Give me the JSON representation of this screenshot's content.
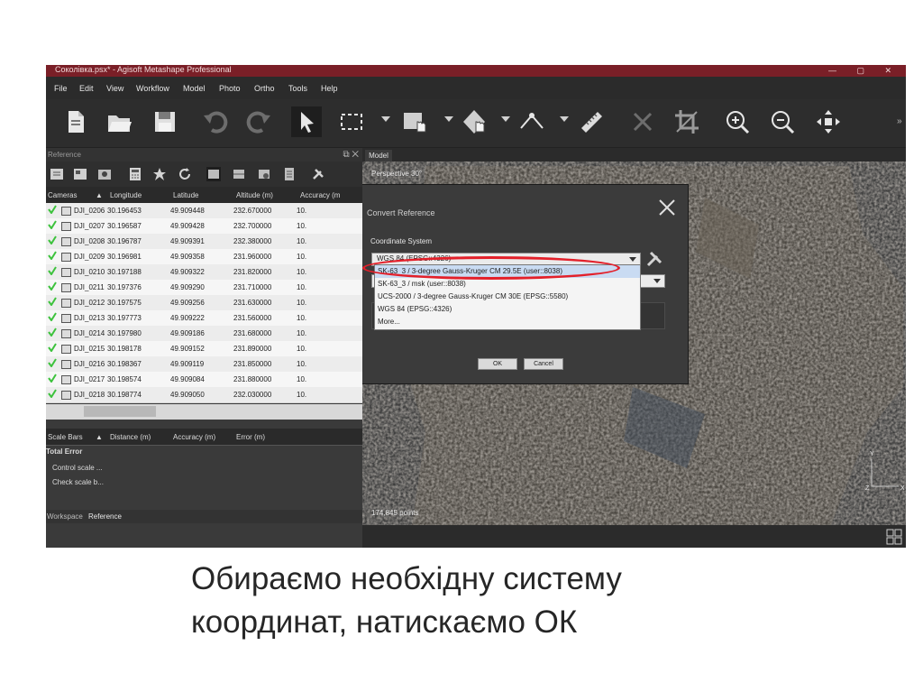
{
  "window": {
    "title": "Соколівка.psx* - Agisoft Metashape Professional",
    "controls": "— ▢ ✕"
  },
  "menu": [
    "File",
    "Edit",
    "View",
    "Workflow",
    "Model",
    "Photo",
    "Ortho",
    "Tools",
    "Help"
  ],
  "toolbar": {
    "icons": [
      "new-document-icon",
      "open-folder-icon",
      "save-icon",
      "undo-icon",
      "redo-icon",
      "pointer-icon",
      "rectangle-selection-icon",
      "move-object-icon",
      "navigate-region-icon",
      "ruler-line-icon",
      "ruler-icon",
      "delete-icon",
      "crop-icon",
      "zoom-in-icon",
      "zoom-out-icon",
      "reset-view-icon"
    ],
    "overflow": "»"
  },
  "reference_panel": {
    "title": "Reference",
    "columns": [
      "Cameras",
      "Longitude",
      "Latitude",
      "Altitude (m)",
      "Accuracy (m"
    ],
    "rows": [
      {
        "label": "DJI_0206",
        "longitude": "30.196453",
        "latitude": "49.909448",
        "altitude": "232.670000",
        "accuracy": "10."
      },
      {
        "label": "DJI_0207",
        "longitude": "30.196587",
        "latitude": "49.909428",
        "altitude": "232.700000",
        "accuracy": "10."
      },
      {
        "label": "DJI_0208",
        "longitude": "30.196787",
        "latitude": "49.909391",
        "altitude": "232.380000",
        "accuracy": "10."
      },
      {
        "label": "DJI_0209",
        "longitude": "30.196981",
        "latitude": "49.909358",
        "altitude": "231.960000",
        "accuracy": "10."
      },
      {
        "label": "DJI_0210",
        "longitude": "30.197188",
        "latitude": "49.909322",
        "altitude": "231.820000",
        "accuracy": "10."
      },
      {
        "label": "DJI_0211",
        "longitude": "30.197376",
        "latitude": "49.909290",
        "altitude": "231.710000",
        "accuracy": "10."
      },
      {
        "label": "DJI_0212",
        "longitude": "30.197575",
        "latitude": "49.909256",
        "altitude": "231.630000",
        "accuracy": "10."
      },
      {
        "label": "DJI_0213",
        "longitude": "30.197773",
        "latitude": "49.909222",
        "altitude": "231.560000",
        "accuracy": "10."
      },
      {
        "label": "DJI_0214",
        "longitude": "30.197980",
        "latitude": "49.909186",
        "altitude": "231.680000",
        "accuracy": "10."
      },
      {
        "label": "DJI_0215",
        "longitude": "30.198178",
        "latitude": "49.909152",
        "altitude": "231.890000",
        "accuracy": "10."
      },
      {
        "label": "DJI_0216",
        "longitude": "30.198367",
        "latitude": "49.909119",
        "altitude": "231.850000",
        "accuracy": "10."
      },
      {
        "label": "DJI_0217",
        "longitude": "30.198574",
        "latitude": "49.909084",
        "altitude": "231.880000",
        "accuracy": "10."
      },
      {
        "label": "DJI_0218",
        "longitude": "30.198774",
        "latitude": "49.909050",
        "altitude": "232.030000",
        "accuracy": "10."
      }
    ],
    "scale_bars_columns": [
      "Scale Bars",
      "Distance (m)",
      "Accuracy (m)",
      "Error (m)"
    ],
    "total_error": "Total Error",
    "control_scale": "Control scale ...",
    "check_scale": "Check scale b...",
    "tabs": [
      "Workspace",
      "Reference"
    ]
  },
  "view": {
    "tab": "Model",
    "perspective": "Perspective 30°",
    "points": "174,845 points",
    "axis_y": "Y",
    "axis_z": "Z",
    "axis_x": "X"
  },
  "dialog": {
    "title": "Convert Reference",
    "section": "Coordinate System",
    "selected": "WGS 84 (EPSG::4326)",
    "options": [
      "SK-63_3 / 3-degree Gauss-Kruger CM 29.5E (user::8038)",
      "SK-63_3 / msk (user::8038)",
      "UCS-2000 / 3-degree Gauss-Kruger CM 30E (EPSG::5580)",
      "WGS 84 (EPSG::4326)",
      "More..."
    ],
    "ok": "OK",
    "cancel": "Cancel"
  },
  "caption": [
    "Обираємо необхідну систему",
    "координат, натискаємо ОК"
  ],
  "colors": {
    "title_bar": "#7a1f27",
    "highlight": "#e3202a",
    "check": "#3cc23c",
    "selection": "#c9dbf2"
  }
}
